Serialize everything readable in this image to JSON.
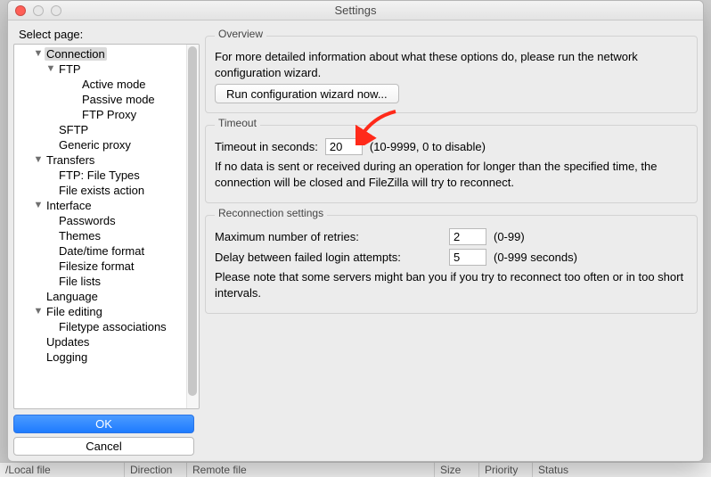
{
  "window": {
    "title": "Settings"
  },
  "sidebar": {
    "heading": "Select page:",
    "items": [
      {
        "label": "Connection",
        "depth": 1,
        "expandable": true,
        "selected": true
      },
      {
        "label": "FTP",
        "depth": 2,
        "expandable": true
      },
      {
        "label": "Active mode",
        "depth": 3
      },
      {
        "label": "Passive mode",
        "depth": 3
      },
      {
        "label": "FTP Proxy",
        "depth": 3
      },
      {
        "label": "SFTP",
        "depth": 2
      },
      {
        "label": "Generic proxy",
        "depth": 2
      },
      {
        "label": "Transfers",
        "depth": 1,
        "expandable": true
      },
      {
        "label": "FTP: File Types",
        "depth": 2
      },
      {
        "label": "File exists action",
        "depth": 2
      },
      {
        "label": "Interface",
        "depth": 1,
        "expandable": true
      },
      {
        "label": "Passwords",
        "depth": 2
      },
      {
        "label": "Themes",
        "depth": 2
      },
      {
        "label": "Date/time format",
        "depth": 2
      },
      {
        "label": "Filesize format",
        "depth": 2
      },
      {
        "label": "File lists",
        "depth": 2
      },
      {
        "label": "Language",
        "depth": 1
      },
      {
        "label": "File editing",
        "depth": 1,
        "expandable": true
      },
      {
        "label": "Filetype associations",
        "depth": 2
      },
      {
        "label": "Updates",
        "depth": 1
      },
      {
        "label": "Logging",
        "depth": 1
      }
    ],
    "ok": "OK",
    "cancel": "Cancel"
  },
  "overview": {
    "legend": "Overview",
    "desc": "For more detailed information about what these options do, please run the network configuration wizard.",
    "button": "Run configuration wizard now..."
  },
  "timeout": {
    "legend": "Timeout",
    "label": "Timeout in seconds:",
    "value": "20",
    "hint": "(10-9999, 0 to disable)",
    "desc": "If no data is sent or received during an operation for longer than the specified time, the connection will be closed and FileZilla will try to reconnect."
  },
  "reconnect": {
    "legend": "Reconnection settings",
    "retries_label": "Maximum number of retries:",
    "retries_value": "2",
    "retries_hint": "(0-99)",
    "delay_label": "Delay between failed login attempts:",
    "delay_value": "5",
    "delay_hint": "(0-999 seconds)",
    "note": "Please note that some servers might ban you if you try to reconnect too often or in too short intervals."
  },
  "status": {
    "local": "/Local file",
    "direction": "Direction",
    "remote": "Remote file",
    "size": "Size",
    "priority": "Priority",
    "status": "Status"
  }
}
